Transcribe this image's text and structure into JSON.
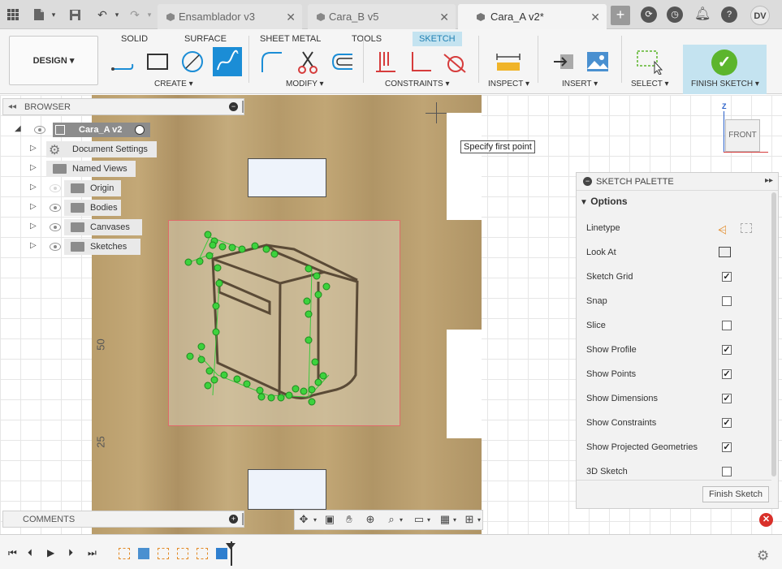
{
  "titlebar": {
    "tabs": [
      {
        "label": "Ensamblador v3",
        "active": false
      },
      {
        "label": "Cara_B v5",
        "active": false
      },
      {
        "label": "Cara_A v2*",
        "active": true
      }
    ],
    "user_initials": "DV"
  },
  "ribbon": {
    "workspace": "DESIGN ▾",
    "tabs": [
      "SOLID",
      "SURFACE",
      "SHEET METAL",
      "TOOLS",
      "SKETCH"
    ],
    "active_tab": "SKETCH",
    "groups": [
      "CREATE ▾",
      "MODIFY ▾",
      "CONSTRAINTS ▾",
      "INSPECT ▾",
      "INSERT ▾",
      "SELECT ▾",
      "FINISH SKETCH ▾"
    ]
  },
  "browser": {
    "title": "BROWSER",
    "root": "Cara_A v2",
    "nodes": [
      "Document Settings",
      "Named Views",
      "Origin",
      "Bodies",
      "Canvases",
      "Sketches"
    ]
  },
  "canvas": {
    "tooltip": "Specify first point",
    "ruler_labels": [
      "50",
      "25"
    ],
    "viewcube_label": "FRONT",
    "viewcube_axis": "Z"
  },
  "palette": {
    "title": "SKETCH PALETTE",
    "section": "Options",
    "rows": [
      {
        "label": "Linetype"
      },
      {
        "label": "Look At"
      },
      {
        "label": "Sketch Grid",
        "checked": true
      },
      {
        "label": "Snap",
        "checked": false
      },
      {
        "label": "Slice",
        "checked": false
      },
      {
        "label": "Show Profile",
        "checked": true
      },
      {
        "label": "Show Points",
        "checked": true
      },
      {
        "label": "Show Dimensions",
        "checked": true
      },
      {
        "label": "Show Constraints",
        "checked": true
      },
      {
        "label": "Show Projected Geometries",
        "checked": true
      },
      {
        "label": "3D Sketch",
        "checked": false
      }
    ],
    "finish_button": "Finish Sketch"
  },
  "comments": {
    "title": "COMMENTS"
  }
}
